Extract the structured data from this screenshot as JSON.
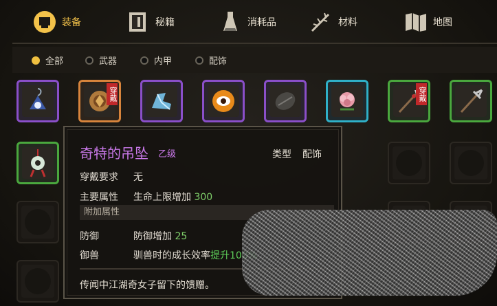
{
  "tabs": [
    {
      "label": "装备",
      "icon": "helmet-icon",
      "active": true
    },
    {
      "label": "秘籍",
      "icon": "book-icon",
      "active": false
    },
    {
      "label": "消耗品",
      "icon": "potion-icon",
      "active": false
    },
    {
      "label": "材料",
      "icon": "herb-icon",
      "active": false
    },
    {
      "label": "地图",
      "icon": "map-icon",
      "active": false
    }
  ],
  "filters": [
    {
      "label": "全部",
      "selected": true
    },
    {
      "label": "武器",
      "selected": false
    },
    {
      "label": "内甲",
      "selected": false
    },
    {
      "label": "配饰",
      "selected": false
    }
  ],
  "slots_row1": [
    {
      "icon": "pendant-icon",
      "rarity": "purple"
    },
    {
      "icon": "shield-amulet-icon",
      "rarity": "orange",
      "badge": "穿戴"
    },
    {
      "icon": "crystal-shoe-icon",
      "rarity": "purple"
    },
    {
      "icon": "eye-orb-icon",
      "rarity": "purple"
    },
    {
      "icon": "dark-stone-icon",
      "rarity": "purple"
    },
    {
      "icon": "flower-icon",
      "rarity": "cyan"
    },
    {
      "icon": "spear-icon",
      "rarity": "green",
      "badge": "穿戴"
    },
    {
      "icon": "trident-icon",
      "rarity": "green"
    }
  ],
  "tooltip": {
    "title": "奇特的吊坠",
    "grade": "乙级",
    "type_label": "类型",
    "type_value": "配饰",
    "requirement_label": "穿戴要求",
    "requirement_value": "无",
    "main_attr_label": "主要属性",
    "main_attr_value": "生命上限增加",
    "main_attr_num": "300",
    "extra_section": "附加属性",
    "defense_label": "防御",
    "defense_value": "防御增加",
    "defense_num": "25",
    "beast_label": "御兽",
    "beast_value": "驯兽时的成长效率",
    "beast_up": "提升100%",
    "description": "传闻中江湖奇女子留下的馈赠。"
  },
  "colors": {
    "accent": "#f3c24a",
    "purple": "#8a4fc9",
    "green": "#4aa83e",
    "cyan": "#2fb0c8",
    "orange": "#d7843c"
  }
}
